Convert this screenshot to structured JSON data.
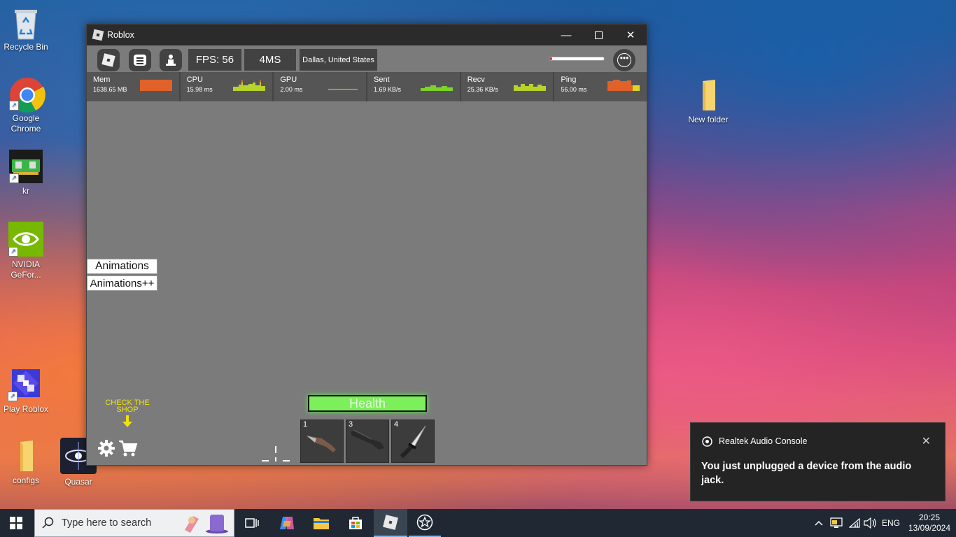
{
  "desktop": {
    "icons": [
      {
        "label": "Recycle Bin"
      },
      {
        "label": "Google Chrome"
      },
      {
        "label": "kr"
      },
      {
        "label": "NVIDIA GeFor..."
      },
      {
        "label": "Play Roblox"
      },
      {
        "label": "configs"
      },
      {
        "label": "Quasar"
      },
      {
        "label": "New folder"
      }
    ]
  },
  "window": {
    "title": "Roblox",
    "fps": "FPS: 56",
    "ms": "4MS",
    "location": "Dallas, United States",
    "stats": [
      {
        "name": "Mem",
        "value": "1638.65 MB"
      },
      {
        "name": "CPU",
        "value": "15.98 ms"
      },
      {
        "name": "GPU",
        "value": "2.00 ms"
      },
      {
        "name": "Sent",
        "value": "1.69 KB/s"
      },
      {
        "name": "Recv",
        "value": "25.36 KB/s"
      },
      {
        "name": "Ping",
        "value": "56.00 ms"
      }
    ],
    "animations_button": "Animations",
    "animations_plus_button": "Animations++",
    "health_label": "Health",
    "shop_hint": "CHECK THE SHOP",
    "hotbar": [
      {
        "slot": "1",
        "item": "knife-icon"
      },
      {
        "slot": "3",
        "item": "shotgun-icon"
      },
      {
        "slot": "4",
        "item": "dagger-icon"
      }
    ]
  },
  "notification": {
    "app": "Realtek Audio Console",
    "message": "You just unplugged a device from the audio jack."
  },
  "taskbar": {
    "search_placeholder": "Type here to search",
    "language": "ENG",
    "time": "20:25",
    "date": "13/09/2024"
  },
  "colors": {
    "health_fill": "#7bf05a",
    "mem_graph": "#e0622a",
    "cpu_graph": "#b8d32a",
    "ping_graph": "#e0622a",
    "shop_hint": "#f2e300"
  }
}
